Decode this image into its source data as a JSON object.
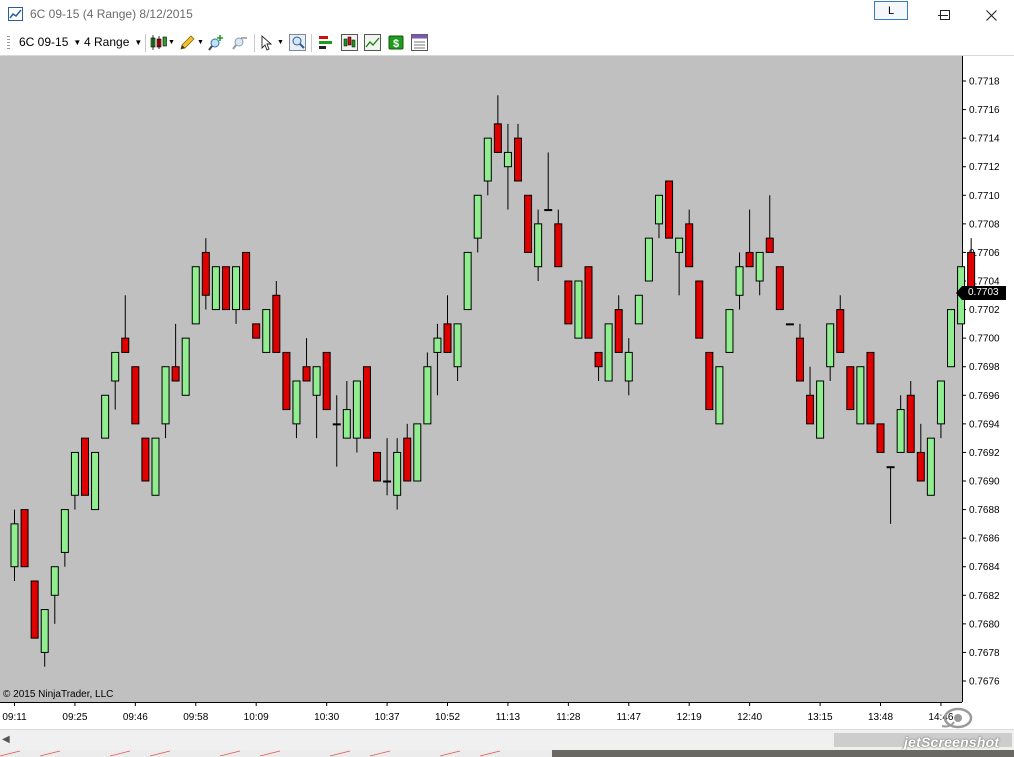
{
  "window": {
    "title": "6C 09-15 (4 Range)  8/12/2015",
    "link_button": "L"
  },
  "toolbar": {
    "instrument": "6C 09-15",
    "period": "4 Range"
  },
  "colors": {
    "chart_background": "#c0c0c0",
    "up_candle": "#90ee90",
    "down_candle": "#e00000",
    "wick": "#000000",
    "price_marker": "#000000"
  },
  "copyright": "© 2015 NinjaTrader, LLC",
  "price_marker": "0.7703",
  "watermark": "jetScreenshot",
  "chart_data": {
    "type": "candlestick",
    "xlabel": "",
    "ylabel": "",
    "grid": false,
    "ylim": [
      0.76745,
      0.77205
    ],
    "y_ticks": [
      "0.7676",
      "0.7678",
      "0.7680",
      "0.7682",
      "0.7684",
      "0.7686",
      "0.7688",
      "0.7690",
      "0.7692",
      "0.7694",
      "0.7696",
      "0.7698",
      "0.7700",
      "0.7702",
      "0.7704",
      "0.7706",
      "0.7708",
      "0.7710",
      "0.7712",
      "0.7714",
      "0.7716",
      "0.7718"
    ],
    "x_ticks": [
      "09:11",
      "09:25",
      "09:46",
      "09:58",
      "10:09",
      "10:30",
      "10:37",
      "10:52",
      "11:13",
      "11:28",
      "11:47",
      "12:19",
      "12:40",
      "13:15",
      "13:48",
      "14:46"
    ],
    "last_price": 0.7703,
    "candles": [
      {
        "o": 0.7684,
        "h": 0.7688,
        "l": 0.7683,
        "c": 0.7687
      },
      {
        "o": 0.7688,
        "h": 0.7688,
        "l": 0.7684,
        "c": 0.7684
      },
      {
        "o": 0.7683,
        "h": 0.7683,
        "l": 0.7679,
        "c": 0.7679
      },
      {
        "o": 0.7678,
        "h": 0.7681,
        "l": 0.7677,
        "c": 0.7681
      },
      {
        "o": 0.7682,
        "h": 0.7684,
        "l": 0.768,
        "c": 0.7684
      },
      {
        "o": 0.7685,
        "h": 0.7688,
        "l": 0.7684,
        "c": 0.7688
      },
      {
        "o": 0.7689,
        "h": 0.7692,
        "l": 0.7688,
        "c": 0.7692
      },
      {
        "o": 0.7693,
        "h": 0.7693,
        "l": 0.7689,
        "c": 0.7689
      },
      {
        "o": 0.7688,
        "h": 0.7692,
        "l": 0.7688,
        "c": 0.7692
      },
      {
        "o": 0.7693,
        "h": 0.7696,
        "l": 0.7693,
        "c": 0.7696
      },
      {
        "o": 0.7697,
        "h": 0.7699,
        "l": 0.7695,
        "c": 0.7699
      },
      {
        "o": 0.77,
        "h": 0.7703,
        "l": 0.7699,
        "c": 0.7699
      },
      {
        "o": 0.7698,
        "h": 0.7698,
        "l": 0.7694,
        "c": 0.7694
      },
      {
        "o": 0.7693,
        "h": 0.7693,
        "l": 0.769,
        "c": 0.769
      },
      {
        "o": 0.7689,
        "h": 0.7693,
        "l": 0.7689,
        "c": 0.7693
      },
      {
        "o": 0.7694,
        "h": 0.7698,
        "l": 0.7693,
        "c": 0.7698
      },
      {
        "o": 0.7698,
        "h": 0.7701,
        "l": 0.7697,
        "c": 0.7697
      },
      {
        "o": 0.7696,
        "h": 0.77,
        "l": 0.7696,
        "c": 0.77
      },
      {
        "o": 0.7701,
        "h": 0.7705,
        "l": 0.7701,
        "c": 0.7705
      },
      {
        "o": 0.7706,
        "h": 0.7707,
        "l": 0.7702,
        "c": 0.7703
      },
      {
        "o": 0.7702,
        "h": 0.7705,
        "l": 0.7702,
        "c": 0.7705
      },
      {
        "o": 0.7705,
        "h": 0.7705,
        "l": 0.7702,
        "c": 0.7702
      },
      {
        "o": 0.7702,
        "h": 0.7705,
        "l": 0.7701,
        "c": 0.7705
      },
      {
        "o": 0.7706,
        "h": 0.7706,
        "l": 0.7702,
        "c": 0.7702
      },
      {
        "o": 0.7701,
        "h": 0.7701,
        "l": 0.77,
        "c": 0.77
      },
      {
        "o": 0.7699,
        "h": 0.7702,
        "l": 0.7699,
        "c": 0.7702
      },
      {
        "o": 0.7703,
        "h": 0.7704,
        "l": 0.7699,
        "c": 0.7699
      },
      {
        "o": 0.7699,
        "h": 0.7699,
        "l": 0.7695,
        "c": 0.7695
      },
      {
        "o": 0.7694,
        "h": 0.7697,
        "l": 0.7693,
        "c": 0.7697
      },
      {
        "o": 0.7698,
        "h": 0.77,
        "l": 0.7697,
        "c": 0.7697
      },
      {
        "o": 0.7696,
        "h": 0.7698,
        "l": 0.7693,
        "c": 0.7698
      },
      {
        "o": 0.7699,
        "h": 0.7699,
        "l": 0.7695,
        "c": 0.7695
      },
      {
        "o": 0.7694,
        "h": 0.7696,
        "l": 0.7691,
        "c": 0.7694
      },
      {
        "o": 0.7693,
        "h": 0.7697,
        "l": 0.7693,
        "c": 0.7695
      },
      {
        "o": 0.7693,
        "h": 0.7697,
        "l": 0.7692,
        "c": 0.7697
      },
      {
        "o": 0.7698,
        "h": 0.7698,
        "l": 0.7693,
        "c": 0.7693
      },
      {
        "o": 0.7692,
        "h": 0.7692,
        "l": 0.769,
        "c": 0.769
      },
      {
        "o": 0.769,
        "h": 0.7693,
        "l": 0.7689,
        "c": 0.769
      },
      {
        "o": 0.7689,
        "h": 0.7693,
        "l": 0.7688,
        "c": 0.7692
      },
      {
        "o": 0.7693,
        "h": 0.7694,
        "l": 0.769,
        "c": 0.769
      },
      {
        "o": 0.769,
        "h": 0.7694,
        "l": 0.769,
        "c": 0.7694
      },
      {
        "o": 0.7694,
        "h": 0.7699,
        "l": 0.7694,
        "c": 0.7698
      },
      {
        "o": 0.7699,
        "h": 0.7701,
        "l": 0.7696,
        "c": 0.77
      },
      {
        "o": 0.7701,
        "h": 0.7703,
        "l": 0.7699,
        "c": 0.7699
      },
      {
        "o": 0.7698,
        "h": 0.7701,
        "l": 0.7697,
        "c": 0.7701
      },
      {
        "o": 0.7702,
        "h": 0.7706,
        "l": 0.7702,
        "c": 0.7706
      },
      {
        "o": 0.7707,
        "h": 0.771,
        "l": 0.7706,
        "c": 0.771
      },
      {
        "o": 0.7711,
        "h": 0.7714,
        "l": 0.771,
        "c": 0.7714
      },
      {
        "o": 0.7715,
        "h": 0.7717,
        "l": 0.7713,
        "c": 0.7713
      },
      {
        "o": 0.7712,
        "h": 0.7715,
        "l": 0.7709,
        "c": 0.7713
      },
      {
        "o": 0.7714,
        "h": 0.7715,
        "l": 0.7711,
        "c": 0.7711
      },
      {
        "o": 0.771,
        "h": 0.771,
        "l": 0.7706,
        "c": 0.7706
      },
      {
        "o": 0.7705,
        "h": 0.7709,
        "l": 0.7704,
        "c": 0.7708
      },
      {
        "o": 0.7709,
        "h": 0.7713,
        "l": 0.7709,
        "c": 0.7709
      },
      {
        "o": 0.7708,
        "h": 0.7709,
        "l": 0.7705,
        "c": 0.7705
      },
      {
        "o": 0.7704,
        "h": 0.7704,
        "l": 0.7701,
        "c": 0.7701
      },
      {
        "o": 0.77,
        "h": 0.7704,
        "l": 0.77,
        "c": 0.7704
      },
      {
        "o": 0.7705,
        "h": 0.7705,
        "l": 0.77,
        "c": 0.77
      },
      {
        "o": 0.7699,
        "h": 0.7699,
        "l": 0.7697,
        "c": 0.7698
      },
      {
        "o": 0.7697,
        "h": 0.7701,
        "l": 0.7697,
        "c": 0.7701
      },
      {
        "o": 0.7702,
        "h": 0.7703,
        "l": 0.7699,
        "c": 0.7699
      },
      {
        "o": 0.7697,
        "h": 0.77,
        "l": 0.7696,
        "c": 0.7699
      },
      {
        "o": 0.7701,
        "h": 0.7703,
        "l": 0.7701,
        "c": 0.7703
      },
      {
        "o": 0.7704,
        "h": 0.7707,
        "l": 0.7704,
        "c": 0.7707
      },
      {
        "o": 0.7708,
        "h": 0.771,
        "l": 0.7707,
        "c": 0.771
      },
      {
        "o": 0.7711,
        "h": 0.7711,
        "l": 0.7707,
        "c": 0.7707
      },
      {
        "o": 0.7706,
        "h": 0.7707,
        "l": 0.7703,
        "c": 0.7707
      },
      {
        "o": 0.7708,
        "h": 0.7709,
        "l": 0.7705,
        "c": 0.7705
      },
      {
        "o": 0.7704,
        "h": 0.7704,
        "l": 0.77,
        "c": 0.77
      },
      {
        "o": 0.7699,
        "h": 0.7699,
        "l": 0.7695,
        "c": 0.7695
      },
      {
        "o": 0.7694,
        "h": 0.7698,
        "l": 0.7694,
        "c": 0.7698
      },
      {
        "o": 0.7699,
        "h": 0.7702,
        "l": 0.7699,
        "c": 0.7702
      },
      {
        "o": 0.7703,
        "h": 0.7706,
        "l": 0.7702,
        "c": 0.7705
      },
      {
        "o": 0.7706,
        "h": 0.7709,
        "l": 0.7705,
        "c": 0.7705
      },
      {
        "o": 0.7704,
        "h": 0.7706,
        "l": 0.7703,
        "c": 0.7706
      },
      {
        "o": 0.7707,
        "h": 0.771,
        "l": 0.7706,
        "c": 0.7706
      },
      {
        "o": 0.7705,
        "h": 0.7705,
        "l": 0.7702,
        "c": 0.7702
      },
      {
        "o": 0.7701,
        "h": 0.7701,
        "l": 0.7701,
        "c": 0.7701
      },
      {
        "o": 0.77,
        "h": 0.7701,
        "l": 0.7697,
        "c": 0.7697
      },
      {
        "o": 0.7696,
        "h": 0.7698,
        "l": 0.7694,
        "c": 0.7694
      },
      {
        "o": 0.7693,
        "h": 0.7697,
        "l": 0.7693,
        "c": 0.7697
      },
      {
        "o": 0.7698,
        "h": 0.7701,
        "l": 0.7697,
        "c": 0.7701
      },
      {
        "o": 0.7702,
        "h": 0.7703,
        "l": 0.7699,
        "c": 0.7699
      },
      {
        "o": 0.7698,
        "h": 0.7698,
        "l": 0.7695,
        "c": 0.7695
      },
      {
        "o": 0.7694,
        "h": 0.7698,
        "l": 0.7694,
        "c": 0.7698
      },
      {
        "o": 0.7699,
        "h": 0.7699,
        "l": 0.7694,
        "c": 0.7694
      },
      {
        "o": 0.7694,
        "h": 0.7694,
        "l": 0.7692,
        "c": 0.7692
      },
      {
        "o": 0.7691,
        "h": 0.7691,
        "l": 0.7687,
        "c": 0.7691
      },
      {
        "o": 0.7692,
        "h": 0.7696,
        "l": 0.7692,
        "c": 0.7695
      },
      {
        "o": 0.7696,
        "h": 0.7697,
        "l": 0.7692,
        "c": 0.7692
      },
      {
        "o": 0.7692,
        "h": 0.7694,
        "l": 0.769,
        "c": 0.769
      },
      {
        "o": 0.7689,
        "h": 0.7693,
        "l": 0.7689,
        "c": 0.7693
      },
      {
        "o": 0.7694,
        "h": 0.7697,
        "l": 0.7693,
        "c": 0.7697
      },
      {
        "o": 0.7698,
        "h": 0.7702,
        "l": 0.7698,
        "c": 0.7702
      },
      {
        "o": 0.7701,
        "h": 0.7705,
        "l": 0.7701,
        "c": 0.7705
      },
      {
        "o": 0.7706,
        "h": 0.7707,
        "l": 0.7703,
        "c": 0.7703
      }
    ]
  }
}
